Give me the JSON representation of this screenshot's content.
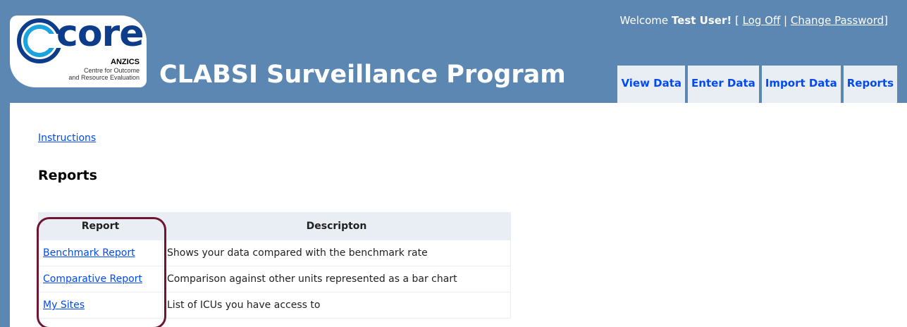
{
  "header": {
    "logo": {
      "word": "core",
      "org": "ANZICS",
      "subtitle_line1": "Centre for Outcome",
      "subtitle_line2": "and Resource Evaluation"
    },
    "app_title": "CLABSI Surveillance Program",
    "login": {
      "welcome": "Welcome ",
      "user": "Test User",
      "excl": "!",
      "open_bracket": " [ ",
      "log_off": "Log Off",
      "separator": " | ",
      "change_password": "Change Password",
      "close_bracket": "]"
    },
    "tabs": [
      {
        "label": "View Data"
      },
      {
        "label": "Enter Data"
      },
      {
        "label": "Import Data"
      },
      {
        "label": "Reports"
      }
    ]
  },
  "main": {
    "instructions_link": "Instructions",
    "heading": "Reports",
    "table": {
      "columns": [
        "Report",
        "Descripton"
      ],
      "rows": [
        {
          "report": "Benchmark Report",
          "description": "Shows your data compared with the benchmark rate"
        },
        {
          "report": "Comparative Report",
          "description": "Comparison against other units represented as a bar chart"
        },
        {
          "report": "My Sites",
          "description": "List of ICUs you have access to"
        }
      ]
    }
  },
  "colors": {
    "page_bg": "#5c87b2",
    "tab_bg": "#e8eef4",
    "link": "#034af3",
    "highlight_border": "#6e1530",
    "logo_blue": "#0d3d8a"
  }
}
